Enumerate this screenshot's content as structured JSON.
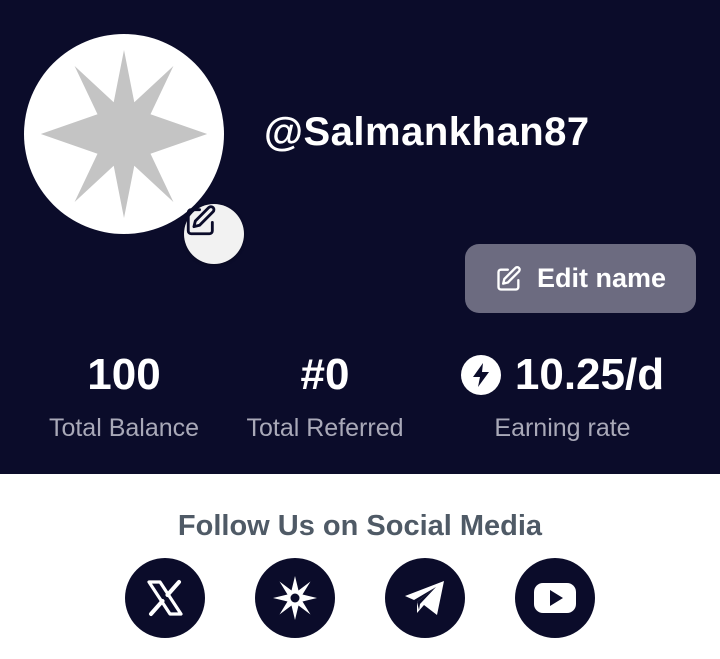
{
  "profile": {
    "username": "@Salmankhan87",
    "edit_name_label": "Edit name",
    "avatar_icon": "star-avatar-icon",
    "avatar_edit_icon": "edit-icon"
  },
  "stats": [
    {
      "value": "100",
      "label": "Total Balance"
    },
    {
      "value": "#0",
      "label": "Total Referred"
    },
    {
      "value": "10.25/d",
      "label": "Earning rate",
      "icon": "lightning-icon"
    }
  ],
  "social": {
    "title": "Follow Us on Social Media",
    "icons": [
      "x-icon",
      "star-icon",
      "telegram-icon",
      "youtube-icon"
    ]
  },
  "colors": {
    "background": "#0b0c2a",
    "button": "#6c6b80",
    "muted_text": "#a9a9b8",
    "social_title": "#4f5a66"
  }
}
